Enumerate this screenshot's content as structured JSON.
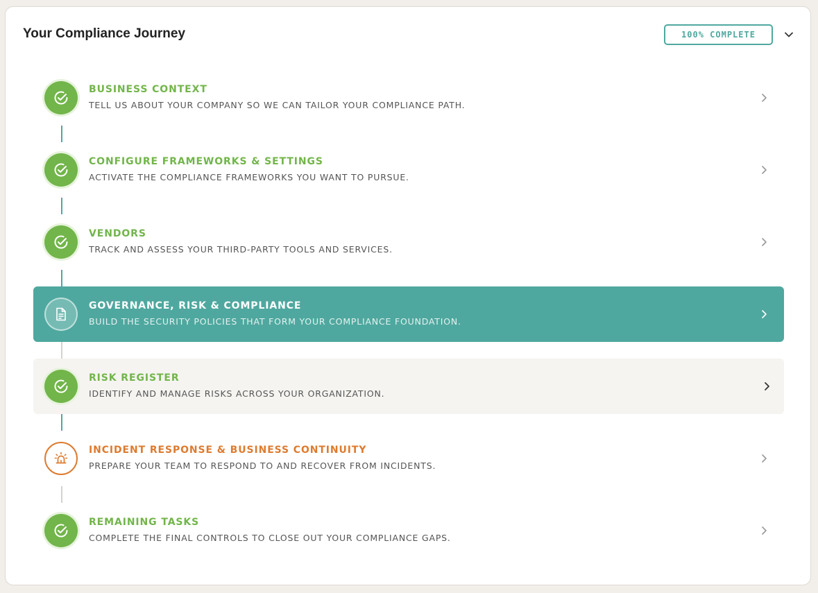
{
  "header": {
    "title": "Your Compliance Journey",
    "badge": "100% COMPLETE"
  },
  "colors": {
    "accent": "#4fa89f",
    "done": "#72b54a",
    "warning": "#dd7b2f"
  },
  "steps": [
    {
      "title": "BUSINESS CONTEXT",
      "description": "TELL US ABOUT YOUR COMPANY SO WE CAN TAILOR YOUR COMPLIANCE PATH.",
      "state": "done",
      "icon": "check-circle-icon"
    },
    {
      "title": "CONFIGURE FRAMEWORKS & SETTINGS",
      "description": "ACTIVATE THE COMPLIANCE FRAMEWORKS YOU WANT TO PURSUE.",
      "state": "done",
      "icon": "check-circle-icon"
    },
    {
      "title": "VENDORS",
      "description": "TRACK AND ASSESS YOUR THIRD-PARTY TOOLS AND SERVICES.",
      "state": "done",
      "icon": "check-circle-icon"
    },
    {
      "title": "GOVERNANCE, RISK & COMPLIANCE",
      "description": "BUILD THE SECURITY POLICIES THAT FORM YOUR COMPLIANCE FOUNDATION.",
      "state": "active",
      "icon": "document-icon"
    },
    {
      "title": "RISK REGISTER",
      "description": "IDENTIFY AND MANAGE RISKS ACROSS YOUR ORGANIZATION.",
      "state": "done",
      "icon": "check-circle-icon"
    },
    {
      "title": "INCIDENT RESPONSE & BUSINESS CONTINUITY",
      "description": "PREPARE YOUR TEAM TO RESPOND TO AND RECOVER FROM INCIDENTS.",
      "state": "warning",
      "icon": "siren-icon"
    },
    {
      "title": "REMAINING TASKS",
      "description": "COMPLETE THE FINAL CONTROLS TO CLOSE OUT YOUR COMPLIANCE GAPS.",
      "state": "done",
      "icon": "check-circle-icon"
    }
  ]
}
